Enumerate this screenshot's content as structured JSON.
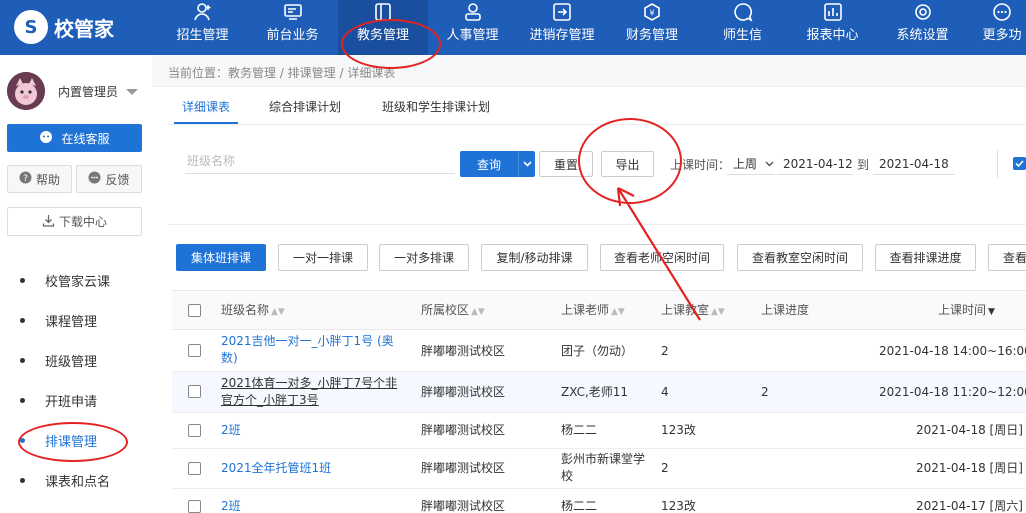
{
  "app": {
    "title": "校管家"
  },
  "nav": [
    {
      "label": "招生管理",
      "icon": "user-plus-icon"
    },
    {
      "label": "前台业务",
      "icon": "monitor-icon"
    },
    {
      "label": "教务管理",
      "icon": "book-icon"
    },
    {
      "label": "人事管理",
      "icon": "person-icon"
    },
    {
      "label": "进销存管理",
      "icon": "inventory-icon"
    },
    {
      "label": "财务管理",
      "icon": "money-icon"
    },
    {
      "label": "师生信",
      "icon": "chat-icon"
    },
    {
      "label": "报表中心",
      "icon": "report-icon"
    },
    {
      "label": "系统设置",
      "icon": "settings-icon"
    },
    {
      "label": "更多功",
      "icon": "more-icon"
    }
  ],
  "sidebar": {
    "user_name": "内置管理员",
    "service_label": "在线客服",
    "help_label": "帮助",
    "feedback_label": "反馈",
    "download_label": "下载中心",
    "items": [
      {
        "label": "校管家云课"
      },
      {
        "label": "课程管理"
      },
      {
        "label": "班级管理"
      },
      {
        "label": "开班申请"
      },
      {
        "label": "排课管理"
      },
      {
        "label": "课表和点名"
      }
    ]
  },
  "breadcrumb": "当前位置：教务管理 / 排课管理 / 详细课表",
  "tabs": [
    {
      "label": "详细课表"
    },
    {
      "label": "综合排课计划"
    },
    {
      "label": "班级和学生排课计划"
    }
  ],
  "filters": {
    "class_placeholder": "班级名称",
    "query_label": "查询",
    "reset_label": "重置",
    "export_label": "导出",
    "time_label": "上课时间：",
    "period_value": "上周",
    "date_from": "2021-04-12",
    "to_label": "到",
    "date_to": "2021-04-18"
  },
  "actions": [
    {
      "label": "集体班排课"
    },
    {
      "label": "一对一排课"
    },
    {
      "label": "一对多排课"
    },
    {
      "label": "复制/移动排课"
    },
    {
      "label": "查看老师空闲时间"
    },
    {
      "label": "查看教室空闲时间"
    },
    {
      "label": "查看排课进度"
    },
    {
      "label": "查看"
    }
  ],
  "table": {
    "columns": [
      "班级名称",
      "所属校区",
      "上课老师",
      "上课教室",
      "上课进度",
      "上课时间"
    ],
    "rows": [
      {
        "class_name": "2021吉他一对一_小胖丁1号 (奥数)",
        "campus": "胖嘟嘟测试校区",
        "teacher": "团子（勿动）",
        "room": "2",
        "progress": "",
        "time": "2021-04-18 14:00~16:00"
      },
      {
        "class_name": "2021体育一对多_小胖丁7号个非官方个_小胖丁3号",
        "campus": "胖嘟嘟测试校区",
        "teacher": "ZXC,老师11",
        "room": "4",
        "progress": "2",
        "time": "2021-04-18 11:20~12:00"
      },
      {
        "class_name": "2班",
        "campus": "胖嘟嘟测试校区",
        "teacher": "杨二二",
        "room": "123改",
        "progress": "",
        "time": "2021-04-18 [周日]"
      },
      {
        "class_name": "2021全年托管班1班",
        "campus": "胖嘟嘟测试校区",
        "teacher": "彭州市新课堂学校",
        "room": "2",
        "progress": "",
        "time": "2021-04-18 [周日]"
      },
      {
        "class_name": "2班",
        "campus": "胖嘟嘟测试校区",
        "teacher": "杨二二",
        "room": "123改",
        "progress": "",
        "time": "2021-04-17 [周六]"
      }
    ]
  },
  "colors": {
    "nav_bg": "#1f5eb8",
    "accent": "#1f73d6",
    "annotation": "#e32222"
  }
}
